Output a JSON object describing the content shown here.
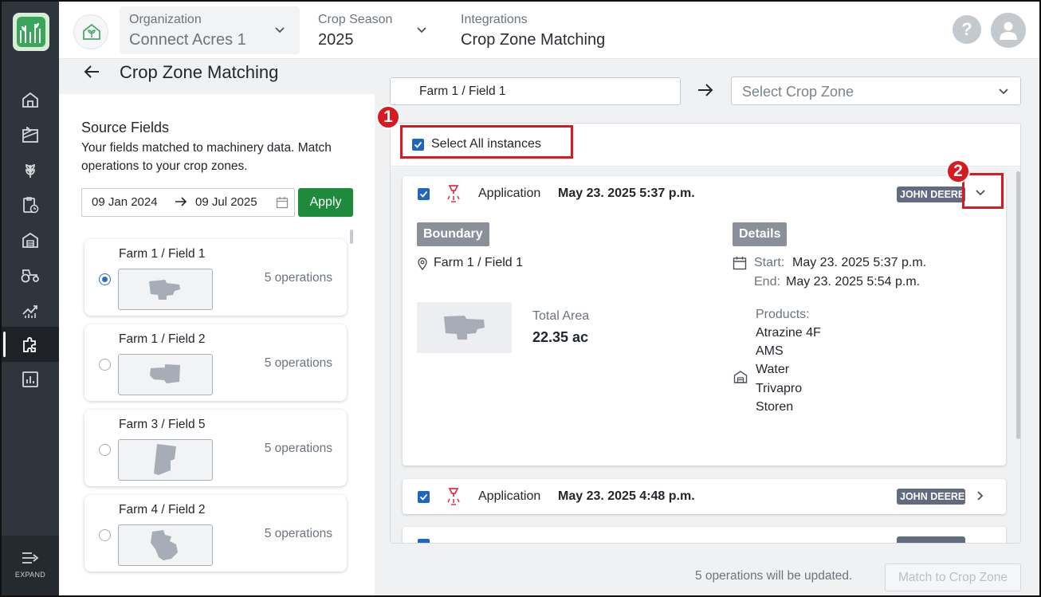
{
  "header": {
    "org_label": "Organization",
    "org_value": "Connect Acres 1",
    "season_label": "Crop Season",
    "season_value": "2025",
    "integrations_label": "Integrations",
    "integrations_value": "Crop Zone Matching",
    "help_glyph": "?"
  },
  "sidebar": {
    "items": [
      {
        "icon": "home-icon"
      },
      {
        "icon": "field-icon"
      },
      {
        "icon": "crop-icon"
      },
      {
        "icon": "schedule-icon"
      },
      {
        "icon": "warehouse-icon"
      },
      {
        "icon": "tractor-icon"
      },
      {
        "icon": "yield-icon"
      },
      {
        "icon": "integrations-puzzle-icon",
        "active": true
      },
      {
        "icon": "reports-icon"
      }
    ],
    "expand_label": "EXPAND"
  },
  "page": {
    "title": "Crop Zone Matching"
  },
  "source": {
    "title": "Source Fields",
    "description": "Your fields matched to machinery data. Match operations to your crop zones.",
    "date_start": "09 Jan 2024",
    "date_end": "09 Jul 2025",
    "apply_label": "Apply",
    "fields": [
      {
        "name": "Farm 1 / Field 1",
        "ops": "5 operations",
        "selected": true
      },
      {
        "name": "Farm 1 / Field 2",
        "ops": "5 operations",
        "selected": false
      },
      {
        "name": "Farm 3 / Field 5",
        "ops": "5 operations",
        "selected": false
      },
      {
        "name": "Farm 4 / Field 2",
        "ops": "5 operations",
        "selected": false
      }
    ]
  },
  "matching": {
    "source_field": "Farm 1 / Field 1",
    "crop_zone_placeholder": "Select Crop Zone",
    "select_all_label": "Select All instances",
    "operations": [
      {
        "type": "Application",
        "date": "May 23. 2025 5:37 p.m.",
        "source": "JOHN DEERE",
        "expanded": true,
        "boundary_tag": "Boundary",
        "field": "Farm 1 / Field 1",
        "total_area_label": "Total Area",
        "total_area": "22.35 ac",
        "details_tag": "Details",
        "start_label": "Start:",
        "start": "May 23. 2025 5:37 p.m.",
        "end_label": "End:",
        "end": "May 23. 2025 5:54 p.m.",
        "products_label": "Products:",
        "products": [
          "Atrazine 4F",
          "AMS",
          "Water",
          "Trivapro",
          "Storen"
        ]
      },
      {
        "type": "Application",
        "date": "May 23. 2025 4:48 p.m.",
        "source": "JOHN DEERE",
        "expanded": false
      }
    ]
  },
  "callouts": [
    "1",
    "2"
  ],
  "footer": {
    "status": "5 operations will be updated.",
    "match_label": "Match to Crop Zone"
  },
  "colors": {
    "sidebar": "#2f353c",
    "primary_green": "#1d8a3c",
    "checkbox_blue": "#1f66bf",
    "callout_red": "#d71920",
    "jd_badge": "#636b80"
  }
}
